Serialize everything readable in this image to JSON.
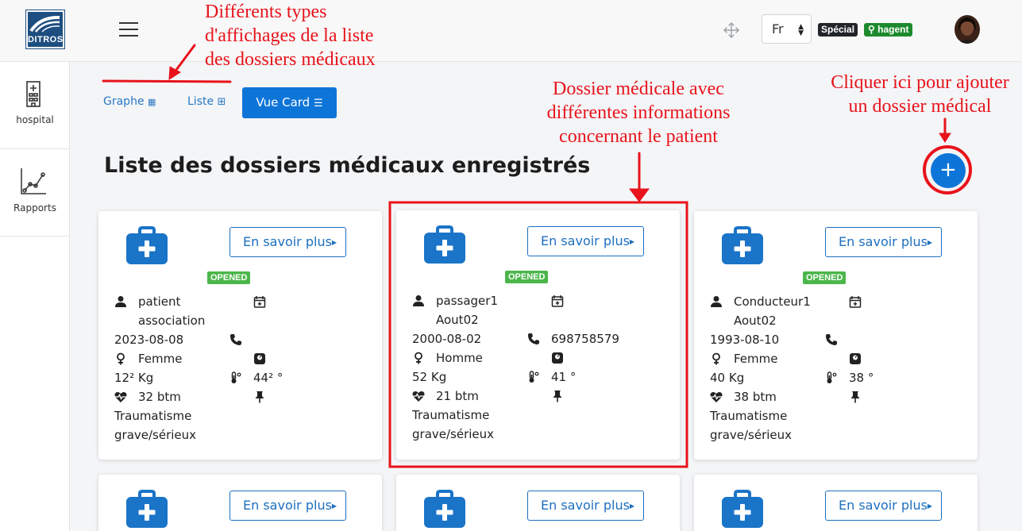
{
  "brand": {
    "logo_text": "DITROS"
  },
  "header": {
    "language": "Fr",
    "badges": {
      "special": "Spécial",
      "user": "hagent"
    }
  },
  "sidebar": {
    "items": [
      {
        "label": "hospital",
        "icon": "hospital-icon"
      },
      {
        "label": "Rapports",
        "icon": "chart-icon"
      }
    ]
  },
  "views": {
    "graph": "Graphe",
    "list": "Liste",
    "card": "Vue Card"
  },
  "main": {
    "title": "Liste des dossiers médicaux enregistrés",
    "add_label": "+"
  },
  "records": [
    {
      "more_label": "En savoir plus",
      "status": "OPENED",
      "name_line1": "patient",
      "name_line2": "association",
      "date": "2023-08-08",
      "phone": "",
      "gender": "Femme",
      "weight": "12² Kg",
      "temperature": "44² °",
      "heart_rate": "32 btm",
      "diagnosis_line1": "Traumatisme",
      "diagnosis_line2": "grave/sérieux"
    },
    {
      "more_label": "En savoir plus",
      "status": "OPENED",
      "name_line1": "passager1",
      "name_line2": "Aout02",
      "date": "2000-08-02",
      "phone": "698758579",
      "gender": "Homme",
      "weight": "52 Kg",
      "temperature": "41 °",
      "heart_rate": "21 btm",
      "diagnosis_line1": "Traumatisme",
      "diagnosis_line2": "grave/sérieux"
    },
    {
      "more_label": "En savoir plus",
      "status": "OPENED",
      "name_line1": "Conducteur1",
      "name_line2": "Aout02",
      "date": "1993-08-10",
      "phone": "",
      "gender": "Femme",
      "weight": "40 Kg",
      "temperature": "38 °",
      "heart_rate": "38 btm",
      "diagnosis_line1": "Traumatisme",
      "diagnosis_line2": "grave/sérieux"
    },
    {
      "more_label": "En savoir plus"
    },
    {
      "more_label": "En savoir plus"
    },
    {
      "more_label": "En savoir plus"
    }
  ],
  "annotations": {
    "views_note": [
      "Différents types",
      "d'affichages de la liste",
      "des dossiers médicaux"
    ],
    "card_note": [
      "Dossier médicale avec",
      "différentes informations",
      "concernant le patient"
    ],
    "add_note": [
      "Cliquer ici pour ajouter",
      "un dossier médical"
    ]
  },
  "colors": {
    "primary": "#0d75d8",
    "status_opened": "#4cb64a",
    "annotation_red": "#e8131b",
    "badge_user": "#1d8a2e"
  }
}
